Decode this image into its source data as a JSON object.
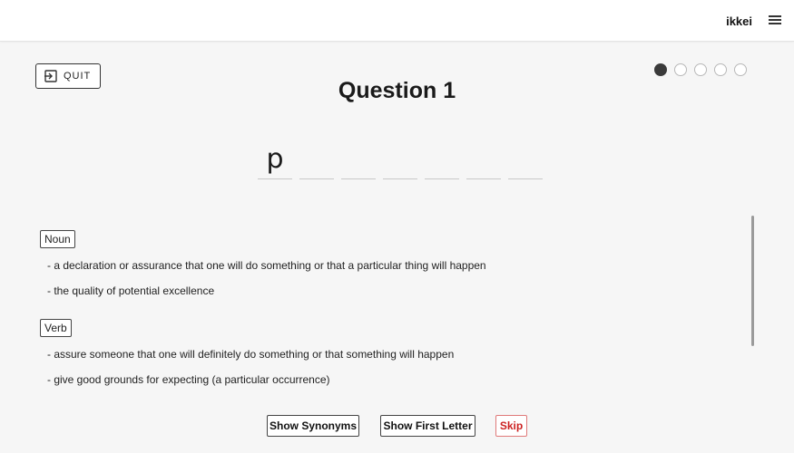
{
  "header": {
    "username": "ikkei",
    "menu_icon": "hamburger-menu-icon"
  },
  "quiz": {
    "quit_label": "QUIT",
    "quit_icon": "exit-icon",
    "title": "Question 1",
    "progress": {
      "current": 1,
      "total": 5
    },
    "letters": [
      "p",
      "",
      "",
      "",
      "",
      "",
      ""
    ]
  },
  "definitions": [
    {
      "pos": "Noun",
      "items": [
        "- a declaration or assurance that one will do something or that a particular thing will happen",
        "- the quality of potential excellence"
      ]
    },
    {
      "pos": "Verb",
      "items": [
        "- assure someone that one will definitely do something or that something will happen",
        "- give good grounds for expecting (a particular occurrence)"
      ]
    }
  ],
  "actions": {
    "show_synonyms": "Show Synonyms",
    "show_first_letter": "Show First Letter",
    "skip": "Skip"
  },
  "colors": {
    "skip": "#cc2222",
    "dot_filled": "#3a3a3a"
  }
}
